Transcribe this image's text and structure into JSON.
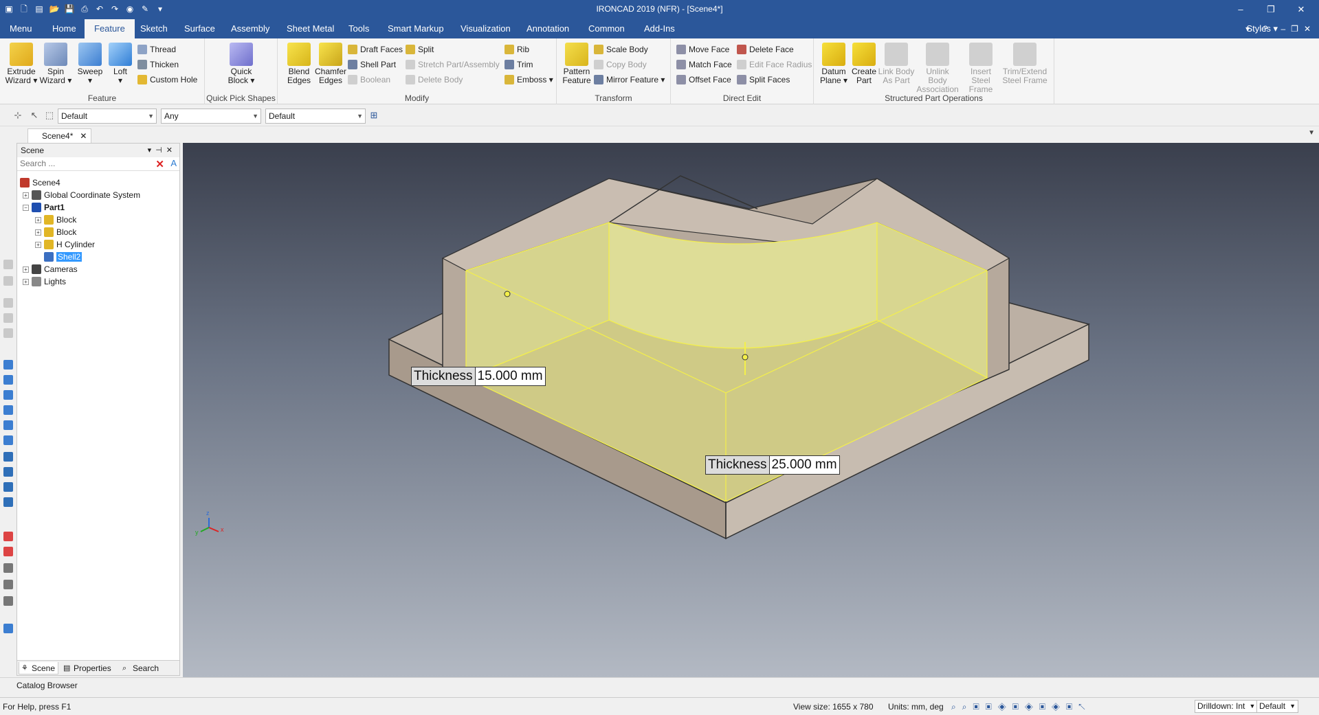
{
  "window": {
    "title": "IRONCAD 2019 (NFR) - [Scene4*]",
    "controls": [
      "–",
      "❐",
      "✕"
    ]
  },
  "menu_tabs": [
    "Menu",
    "Home",
    "Feature",
    "Sketch",
    "Surface",
    "Assembly",
    "Sheet Metal",
    "Tools",
    "Smart Markup",
    "Visualization",
    "Annotation",
    "Common",
    "Add-Ins"
  ],
  "active_tab": "Feature",
  "styles_label": "Styles",
  "ribbon": {
    "feature": {
      "label": "Feature",
      "extrude": "Extrude Wizard",
      "spin": "Spin Wizard",
      "sweep": "Sweep",
      "loft": "Loft",
      "thread": "Thread",
      "thicken": "Thicken",
      "custom_hole": "Custom Hole"
    },
    "quick_pick": {
      "label": "Quick Pick Shapes",
      "quick_block": "Quick Block"
    },
    "modify": {
      "label": "Modify",
      "blend": "Blend Edges",
      "chamfer": "Chamfer Edges",
      "draft_faces": "Draft Faces",
      "shell_part": "Shell Part",
      "boolean": "Boolean",
      "split": "Split",
      "stretch": "Stretch Part/Assembly",
      "delete_body": "Delete Body",
      "rib": "Rib",
      "trim": "Trim",
      "emboss": "Emboss"
    },
    "transform": {
      "label": "Transform",
      "pattern": "Pattern Feature",
      "scale_body": "Scale Body",
      "copy_body": "Copy Body",
      "mirror": "Mirror Feature"
    },
    "direct_edit": {
      "label": "Direct Edit",
      "move_face": "Move Face",
      "match_face": "Match Face",
      "offset_face": "Offset Face",
      "delete_face": "Delete Face",
      "edit_face_radius": "Edit Face Radius",
      "split_faces": "Split Faces"
    },
    "structured": {
      "label": "Structured Part Operations",
      "datum_plane": "Datum Plane",
      "create_part": "Create Part",
      "link_body": "Link Body As Part",
      "unlink_body": "Unlink Body Association",
      "insert_steel": "Insert Steel Frame",
      "trim_extend": "Trim/Extend Steel Frame"
    }
  },
  "toolbar2": {
    "combo1": "Default",
    "combo2": "Any",
    "combo3": "Default"
  },
  "doc_tab": "Scene4*",
  "scene_panel": {
    "title": "Scene",
    "search_placeholder": "Search ...",
    "tree": {
      "root": "Scene4",
      "gcs": "Global Coordinate System",
      "part1": "Part1",
      "block1": "Block",
      "block2": "Block",
      "hcyl": "H Cylinder",
      "shell2": "Shell2",
      "cameras": "Cameras",
      "lights": "Lights"
    },
    "footer_tabs": [
      "Scene",
      "Properties",
      "Search"
    ]
  },
  "viewport": {
    "dim1": {
      "label": "Thickness",
      "value": "15.000 mm"
    },
    "dim2": {
      "label": "Thickness",
      "value": "25.000 mm"
    },
    "axis_labels": {
      "x": "x",
      "y": "y",
      "z": "z"
    }
  },
  "catalog_browser": "Catalog Browser",
  "status": {
    "help": "For Help, press F1",
    "view_size": "View size: 1655 x  780",
    "units": "Units: mm, deg",
    "drilldown": "Drilldown: Int",
    "style_combo": "Default"
  },
  "colors": {
    "titlebar": "#2b579a",
    "solid_face": "#b8ab9f",
    "selected_face": "#dedd97",
    "highlight_edge": "#f4f04a"
  }
}
